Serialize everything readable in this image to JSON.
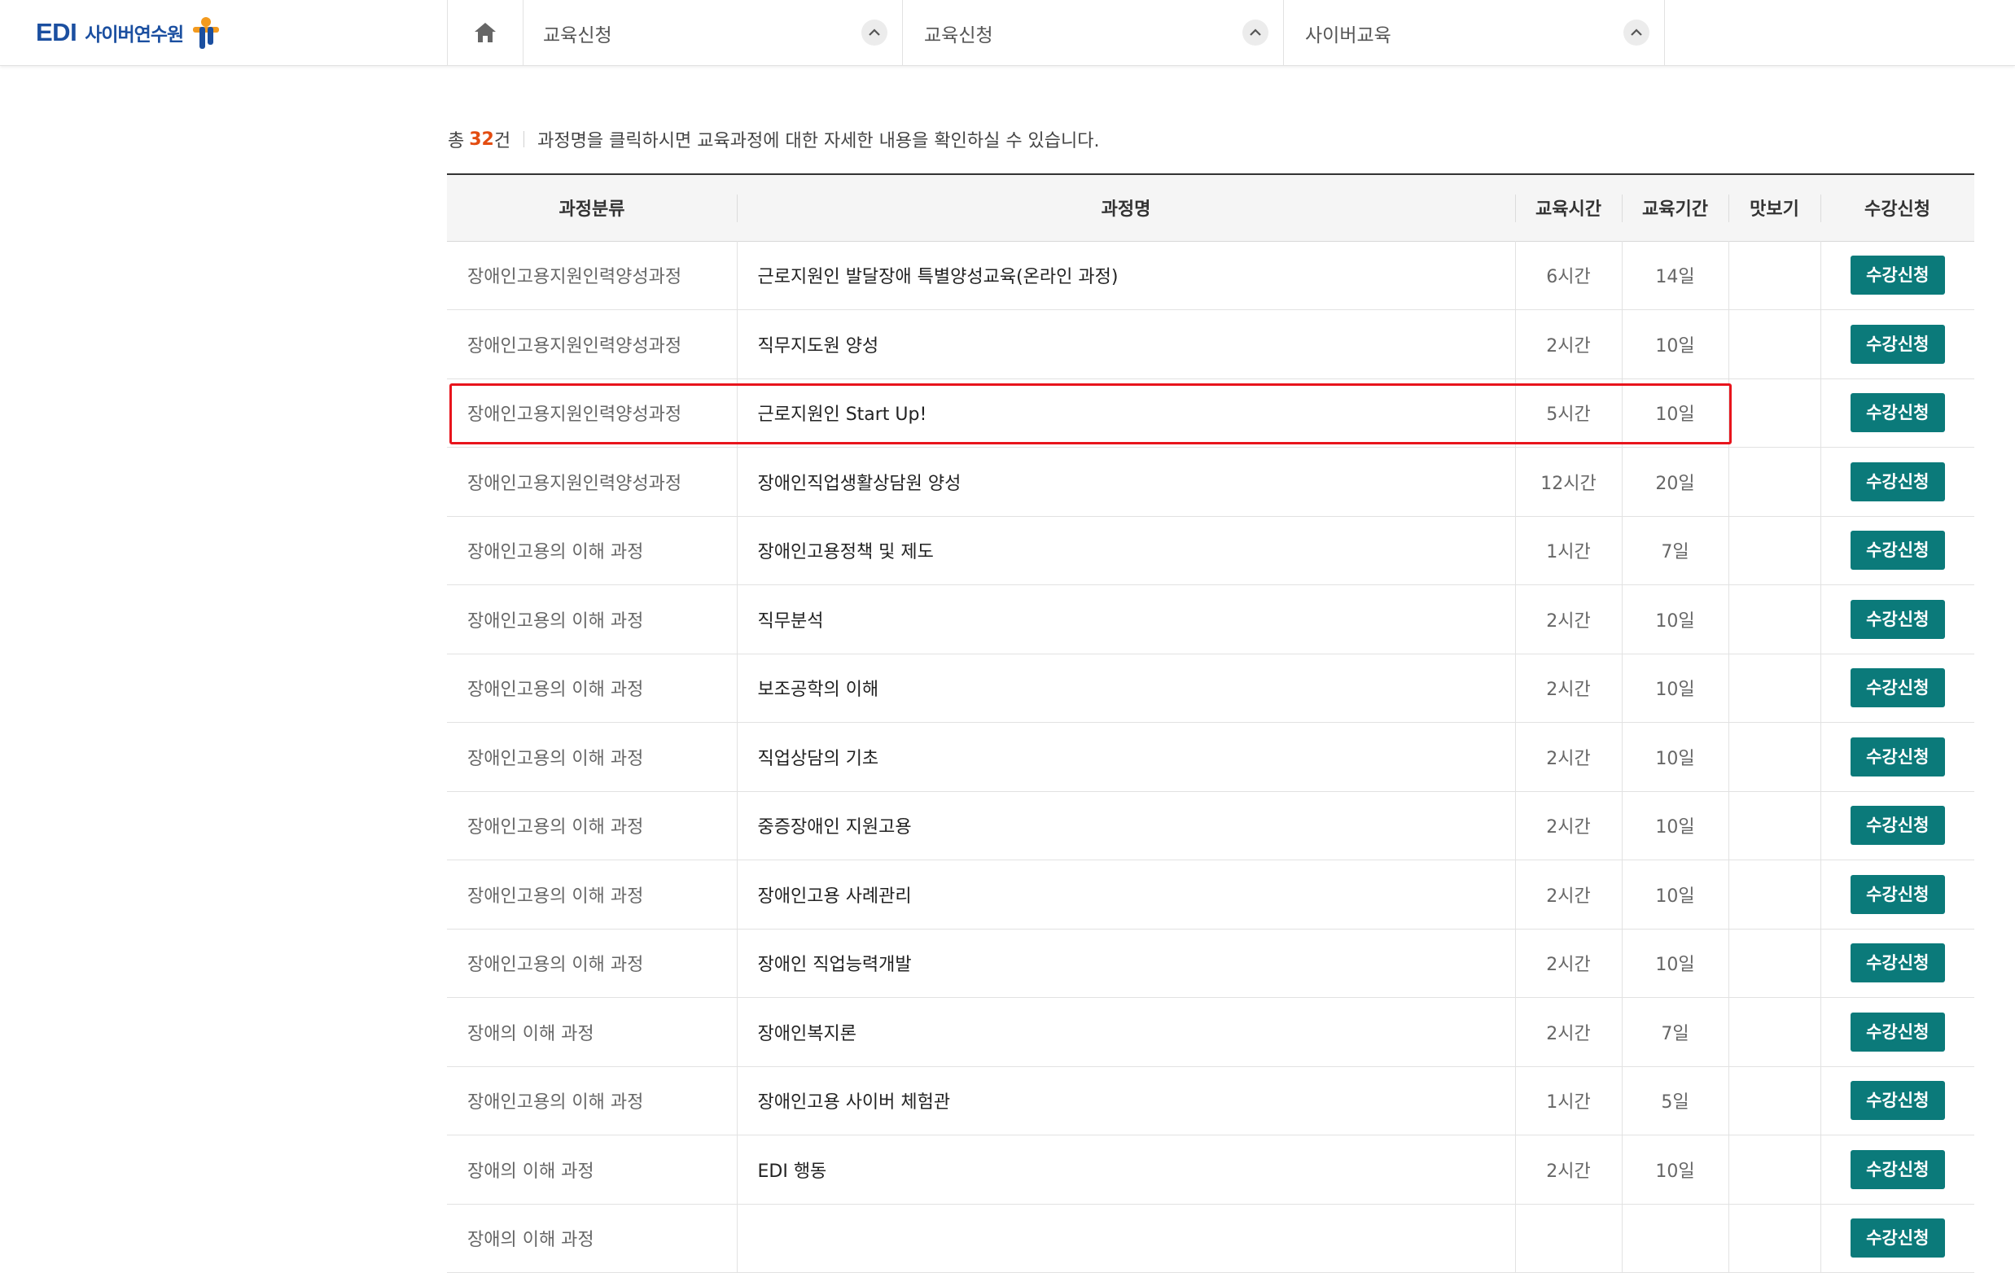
{
  "header": {
    "logo_text": "EDI",
    "logo_sub": "사이버연수원",
    "home_icon": "home-icon",
    "nav": [
      {
        "label": "교육신청",
        "toggle_icon": "chevron-up-icon"
      },
      {
        "label": "교육신청",
        "toggle_icon": "chevron-up-icon"
      },
      {
        "label": "사이버교육",
        "toggle_icon": "chevron-up-icon"
      }
    ],
    "colors": {
      "brand_blue": "#1b4fa0",
      "brand_orange": "#f39a1e"
    }
  },
  "summary": {
    "prefix": "총",
    "count": "32",
    "suffix": "건",
    "description": "과정명을 클릭하시면 교육과정에 대한 자세한 내용을 확인하실 수 있습니다."
  },
  "table": {
    "headers": [
      "과정분류",
      "과정명",
      "교육시간",
      "교육기간",
      "맛보기",
      "수강신청"
    ],
    "button_label": "수강신청",
    "button_color": "#0b7a7a",
    "highlight_color": "#e8141c",
    "rows": [
      {
        "category": "장애인고용지원인력양성과정",
        "name": "근로지원인 발달장애 특별양성교육(온라인 과정)",
        "hours": "6시간",
        "period": "14일",
        "preview": ""
      },
      {
        "category": "장애인고용지원인력양성과정",
        "name": "직무지도원 양성",
        "hours": "2시간",
        "period": "10일",
        "preview": ""
      },
      {
        "category": "장애인고용지원인력양성과정",
        "name": "근로지원인 Start Up!",
        "hours": "5시간",
        "period": "10일",
        "preview": ""
      },
      {
        "category": "장애인고용지원인력양성과정",
        "name": "장애인직업생활상담원 양성",
        "hours": "12시간",
        "period": "20일",
        "preview": ""
      },
      {
        "category": "장애인고용의 이해 과정",
        "name": "장애인고용정책 및 제도",
        "hours": "1시간",
        "period": "7일",
        "preview": ""
      },
      {
        "category": "장애인고용의 이해 과정",
        "name": "직무분석",
        "hours": "2시간",
        "period": "10일",
        "preview": ""
      },
      {
        "category": "장애인고용의 이해 과정",
        "name": "보조공학의 이해",
        "hours": "2시간",
        "period": "10일",
        "preview": ""
      },
      {
        "category": "장애인고용의 이해 과정",
        "name": "직업상담의 기초",
        "hours": "2시간",
        "period": "10일",
        "preview": ""
      },
      {
        "category": "장애인고용의 이해 과정",
        "name": "중증장애인 지원고용",
        "hours": "2시간",
        "period": "10일",
        "preview": ""
      },
      {
        "category": "장애인고용의 이해 과정",
        "name": "장애인고용 사례관리",
        "hours": "2시간",
        "period": "10일",
        "preview": ""
      },
      {
        "category": "장애인고용의 이해 과정",
        "name": "장애인 직업능력개발",
        "hours": "2시간",
        "period": "10일",
        "preview": ""
      },
      {
        "category": "장애의 이해 과정",
        "name": "장애인복지론",
        "hours": "2시간",
        "period": "7일",
        "preview": ""
      },
      {
        "category": "장애인고용의 이해 과정",
        "name": "장애인고용 사이버 체험관",
        "hours": "1시간",
        "period": "5일",
        "preview": ""
      },
      {
        "category": "장애의 이해 과정",
        "name": "EDI 행동",
        "hours": "2시간",
        "period": "10일",
        "preview": ""
      },
      {
        "category": "장애의 이해 과정",
        "name": "",
        "hours": "",
        "period": "",
        "preview": ""
      }
    ]
  }
}
